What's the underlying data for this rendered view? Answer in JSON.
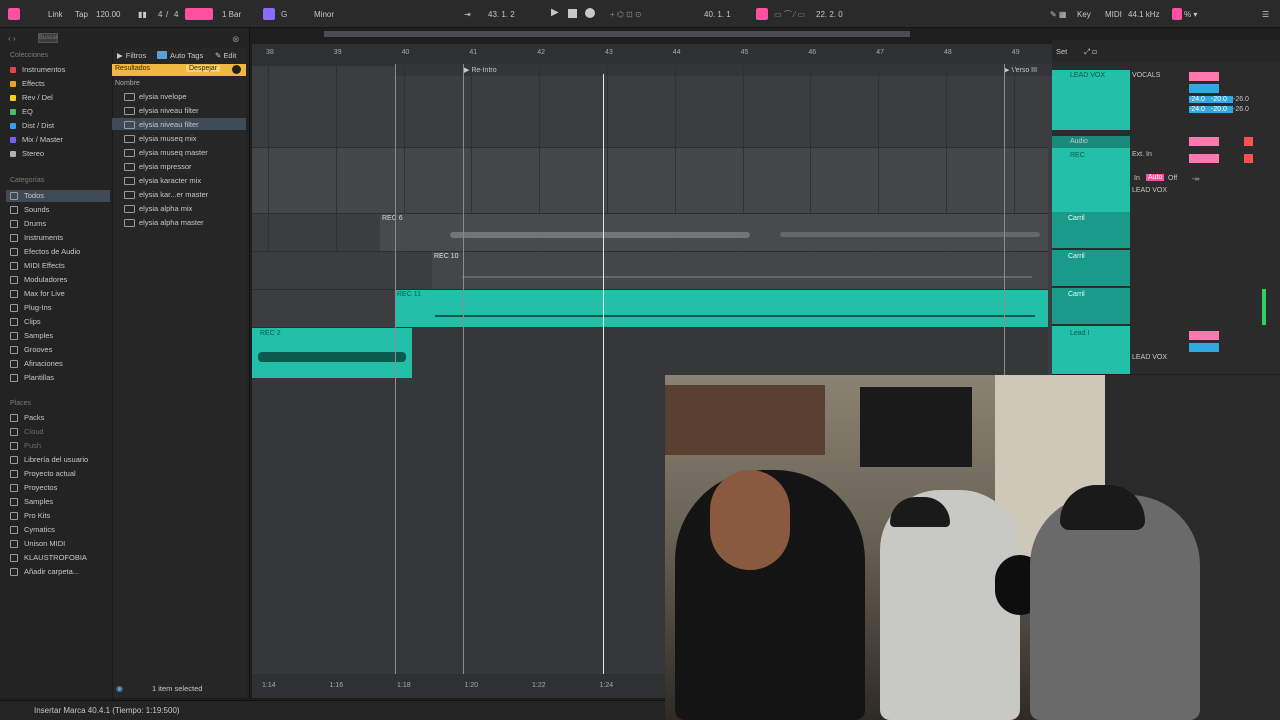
{
  "topbar": {
    "link": "Link",
    "tap": "Tap",
    "tempo": "120.00",
    "meter_num": "4",
    "meter_den": "4",
    "quant": "1 Bar",
    "key": "G",
    "scale": "Minor",
    "position": "43.  1.  2",
    "loop_start": "40.  1.  1",
    "loop_len": "22.  2.  0",
    "key_btn": "Key",
    "midi_btn": "MIDI",
    "sample_rate": "44.1 kHz",
    "cpu": "% ▾"
  },
  "browser": {
    "search_placeholder": "Buscar",
    "collections_title": "Colecciones",
    "collections": [
      {
        "label": "Instrumentos",
        "color": "#e64545"
      },
      {
        "label": "Effects",
        "color": "#f0a020"
      },
      {
        "label": "Rev / Del",
        "color": "#f0d020"
      },
      {
        "label": "EQ",
        "color": "#40c060"
      },
      {
        "label": "Dist / Dist",
        "color": "#30a0f0"
      },
      {
        "label": "Mix / Master",
        "color": "#7a60f0"
      },
      {
        "label": "Stereo",
        "color": "#b0b0b0"
      }
    ],
    "categories_title": "Categorías",
    "categories": [
      "Todos",
      "Sounds",
      "Drums",
      "Instruments",
      "Efectos de Audio",
      "MIDI Effects",
      "Moduladores",
      "Max for Live",
      "Plug-Ins",
      "Clips",
      "Samples",
      "Grooves",
      "Afinaciones",
      "Plantillas"
    ],
    "places_title": "Places",
    "places": [
      "Packs",
      "Cloud",
      "Push",
      "Librería del usuario",
      "Proyecto actual",
      "Proyectos",
      "Samples",
      "Pro Kits",
      "Cymatics",
      "Unison MIDI",
      "KLAUSTROFOBIA",
      "Añadir carpeta..."
    ],
    "filter_btn": "Filtros",
    "autotags_btn": "Auto Tags",
    "edit_btn": "Edit",
    "results_label": "Resultados",
    "clear_btn": "Despejar",
    "name_header": "Nombre",
    "files": [
      "elysia nvelope",
      "elysia niveau filter",
      "elysia niveau filter",
      "elysia museq mix",
      "elysia museq master",
      "elysia mpressor",
      "elysia karacter mix",
      "elysia kar...er master",
      "elysia alpha mix",
      "elysia alpha master"
    ],
    "selected_count": "1 item selected"
  },
  "arrangement": {
    "bars": [
      "38",
      "39",
      "40",
      "41",
      "42",
      "43",
      "44",
      "45",
      "46",
      "47",
      "48",
      "49"
    ],
    "locators": [
      "Re-Intro",
      "Verso III"
    ],
    "time_marks": [
      "1:14",
      "1:16",
      "1:18",
      "1:20",
      "1:22",
      "1:24"
    ],
    "clips": [
      "REC 6",
      "REC 10",
      "REC 11",
      "REC 2"
    ]
  },
  "mixer": {
    "set_btn": "Set",
    "tracks": [
      {
        "name": "LEAD VOX",
        "route": "VOCALS"
      },
      {
        "name": "Audio",
        "route": ""
      },
      {
        "name": "REC",
        "route": "Ext. In"
      },
      {
        "name": "Carril",
        "route": ""
      },
      {
        "name": "Carril",
        "route": ""
      },
      {
        "name": "Carril",
        "route": ""
      },
      {
        "name": "Lead I",
        "route": "LEAD VOX"
      }
    ],
    "in_label": "In",
    "auto_label": "Auto",
    "off_label": "Off",
    "vol_values": [
      "-24.0",
      "-20.0",
      "-26.0",
      "-24.0",
      "-20.0",
      "-26.0"
    ],
    "neg_inf": "-∞",
    "output_label": "LEAD VOX"
  },
  "status": {
    "text": "Insertar Marca 40.4.1 (Tiempo: 1:19:500)"
  }
}
